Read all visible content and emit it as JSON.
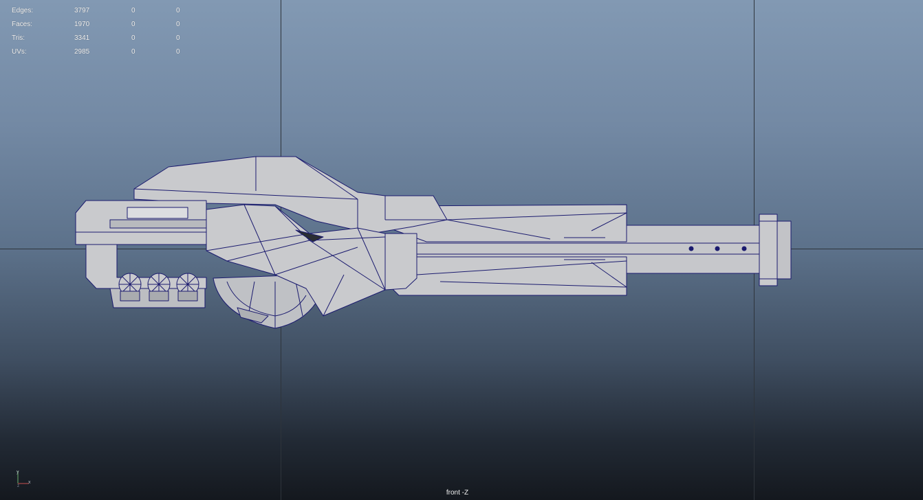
{
  "hud": {
    "rows": [
      {
        "label": "Edges:",
        "v1": "3797",
        "v2": "0",
        "v3": "0"
      },
      {
        "label": "Faces:",
        "v1": "1970",
        "v2": "0",
        "v3": "0"
      },
      {
        "label": "Tris:",
        "v1": "3341",
        "v2": "0",
        "v3": "0"
      },
      {
        "label": "UVs:",
        "v1": "2985",
        "v2": "0",
        "v3": "0"
      }
    ]
  },
  "camera": {
    "label": "front -Z"
  },
  "axis_gizmo": {
    "x_label": "x",
    "y_label": "y",
    "z_label": "z"
  },
  "colors": {
    "wire": "#1a1a6e",
    "surface": "#c9cacd",
    "surface_dark": "#a9abaf",
    "grid": "#2e343b"
  }
}
